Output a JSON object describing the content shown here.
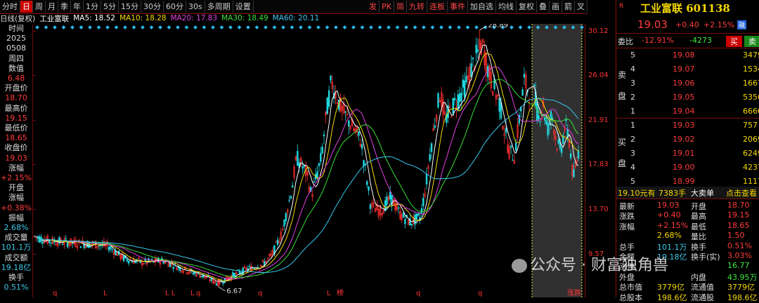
{
  "toolbar": {
    "left": [
      "分时",
      "日",
      "周",
      "月",
      "季",
      "年",
      "1分",
      "5分",
      "15分",
      "30分",
      "60分",
      "30s",
      "多周期",
      "设置"
    ],
    "active_index": 1,
    "right": [
      "发",
      "PK",
      "简",
      "九转",
      "连板",
      "事件",
      "加自选",
      "均线",
      "复权",
      "叠",
      "画",
      "箭",
      "叉"
    ]
  },
  "ma": {
    "label": "日线(复权)",
    "stock": "工业富联",
    "items": [
      {
        "text": "MA5: 18.52",
        "color": "#ffffff"
      },
      {
        "text": "MA10: 18.28",
        "color": "#f5d800"
      },
      {
        "text": "MA20: 17.83",
        "color": "#e040e0"
      },
      {
        "text": "MA30: 18.49",
        "color": "#38e038"
      },
      {
        "text": "MA60: 20.11",
        "color": "#38c8f0"
      }
    ]
  },
  "left_info": [
    {
      "t": "时间",
      "c": "lbl"
    },
    {
      "t": "2025",
      "c": "lbl"
    },
    {
      "t": "0508",
      "c": "lbl"
    },
    {
      "t": "周四",
      "c": "lbl"
    },
    {
      "t": "数值",
      "c": "lbl"
    },
    {
      "t": "6.48",
      "c": "up"
    },
    {
      "t": "开盘价",
      "c": "lbl"
    },
    {
      "t": "18.70",
      "c": "up"
    },
    {
      "t": "最高价",
      "c": "lbl"
    },
    {
      "t": "19.15",
      "c": "up"
    },
    {
      "t": "最低价",
      "c": "lbl"
    },
    {
      "t": "18.65",
      "c": "up"
    },
    {
      "t": "收盘价",
      "c": "lbl"
    },
    {
      "t": "19.03",
      "c": "up"
    },
    {
      "t": "涨幅",
      "c": "lbl"
    },
    {
      "t": "+2.15%",
      "c": "up"
    },
    {
      "t": "开盘",
      "c": "lbl"
    },
    {
      "t": "涨幅",
      "c": "lbl"
    },
    {
      "t": "+0.38%",
      "c": "up"
    },
    {
      "t": "振幅",
      "c": "lbl"
    },
    {
      "t": "2.68%",
      "c": "cy"
    },
    {
      "t": "成交量",
      "c": "lbl"
    },
    {
      "t": "101.1万",
      "c": "cy"
    },
    {
      "t": "成交额",
      "c": "lbl"
    },
    {
      "t": "19.18亿",
      "c": "cy"
    },
    {
      "t": "换手",
      "c": "lbl"
    },
    {
      "t": "0.51%",
      "c": "cy"
    }
  ],
  "axis_labels": [
    "30.12",
    "26.04",
    "21.91",
    "17.83",
    "13.70",
    "9.57"
  ],
  "chart_data": {
    "type": "candlestick",
    "y_ticks": [
      30.12,
      26.04,
      21.91,
      17.83,
      13.7,
      9.57
    ],
    "ylim": [
      5.6,
      30.8
    ],
    "annotations": [
      {
        "text": "28.89",
        "kind": "high"
      },
      {
        "text": "6.67",
        "kind": "low"
      }
    ],
    "price_path": [
      [
        0,
        11.2
      ],
      [
        0.03,
        10.8
      ],
      [
        0.08,
        10.6
      ],
      [
        0.12,
        10.5
      ],
      [
        0.15,
        10.3
      ],
      [
        0.18,
        9.2
      ],
      [
        0.22,
        8.8
      ],
      [
        0.26,
        9.0
      ],
      [
        0.3,
        8.2
      ],
      [
        0.34,
        7.6
      ],
      [
        0.37,
        6.9
      ],
      [
        0.4,
        7.6
      ],
      [
        0.43,
        8.2
      ],
      [
        0.46,
        8.6
      ],
      [
        0.48,
        9.5
      ],
      [
        0.5,
        11.5
      ],
      [
        0.52,
        15.5
      ],
      [
        0.53,
        18.5
      ],
      [
        0.55,
        17.0
      ],
      [
        0.56,
        15.0
      ],
      [
        0.58,
        18.5
      ],
      [
        0.59,
        22.5
      ],
      [
        0.6,
        25.5
      ],
      [
        0.62,
        23.0
      ],
      [
        0.64,
        21.5
      ],
      [
        0.66,
        20.0
      ],
      [
        0.67,
        17.0
      ],
      [
        0.68,
        14.0
      ],
      [
        0.7,
        13.5
      ],
      [
        0.72,
        14.8
      ],
      [
        0.74,
        13.2
      ],
      [
        0.76,
        12.5
      ],
      [
        0.78,
        13.0
      ],
      [
        0.79,
        15.5
      ],
      [
        0.8,
        19.0
      ],
      [
        0.81,
        22.0
      ],
      [
        0.82,
        24.5
      ],
      [
        0.83,
        22.0
      ],
      [
        0.85,
        23.5
      ],
      [
        0.87,
        25.0
      ],
      [
        0.89,
        27.5
      ],
      [
        0.905,
        28.89
      ],
      [
        0.92,
        26.0
      ],
      [
        0.94,
        23.5
      ],
      [
        0.95,
        21.0
      ],
      [
        0.96,
        19.0
      ],
      [
        0.97,
        18.6
      ],
      [
        0.98,
        22.0
      ],
      [
        0.99,
        25.5
      ],
      [
        1.0,
        24.5
      ]
    ],
    "price_path_tail": [
      [
        0,
        24.5
      ],
      [
        0.1,
        22.0
      ],
      [
        0.2,
        23.5
      ],
      [
        0.3,
        21.0
      ],
      [
        0.4,
        22.5
      ],
      [
        0.5,
        20.0
      ],
      [
        0.6,
        19.0
      ],
      [
        0.7,
        21.5
      ],
      [
        0.8,
        20.0
      ],
      [
        0.88,
        16.5
      ],
      [
        0.94,
        17.5
      ],
      [
        1.0,
        19.03
      ]
    ],
    "highlight_region": true,
    "bottom_markers": [
      "q",
      "L",
      "L L",
      "L",
      "q",
      "q",
      "L",
      "榜",
      "q",
      "q",
      "涨跌"
    ]
  },
  "panel": {
    "title": "工业富联 601138",
    "price": "19.03",
    "change": "+0.40",
    "pct": "+2.15%",
    "badge": "融",
    "weibi_label": "委比",
    "weibi": "-12.91%",
    "weicha": "-4273",
    "buy_btn": "买",
    "sell_btn": "卖",
    "sell_label": "卖盘",
    "buy_label": "买盘",
    "asks": [
      {
        "lvl": "5",
        "price": "19.08",
        "vol": "3479"
      },
      {
        "lvl": "4",
        "price": "19.07",
        "vol": "1534"
      },
      {
        "lvl": "3",
        "price": "19.06",
        "vol": "1667"
      },
      {
        "lvl": "2",
        "price": "19.05",
        "vol": "5356"
      },
      {
        "lvl": "1",
        "price": "19.04",
        "vol": "6660"
      }
    ],
    "bids": [
      {
        "lvl": "1",
        "price": "19.03",
        "vol": "757"
      },
      {
        "lvl": "2",
        "price": "19.02",
        "vol": "2069"
      },
      {
        "lvl": "3",
        "price": "19.01",
        "vol": "6249"
      },
      {
        "lvl": "4",
        "price": "19.00",
        "vol": "4237"
      },
      {
        "lvl": "5",
        "price": "18.99",
        "vol": "1117"
      }
    ],
    "big_order": {
      "a": "19.10元有",
      "b": "7383手",
      "c": "大卖单",
      "d": "点击查看"
    },
    "stats": [
      {
        "l1": "最新",
        "v1": "19.03",
        "c1": "up",
        "l2": "开盘",
        "v2": "18.70",
        "c2": "up"
      },
      {
        "l1": "涨跌",
        "v1": "+0.40",
        "c1": "up",
        "l2": "最高",
        "v2": "19.15",
        "c2": "up"
      },
      {
        "l1": "涨幅",
        "v1": "+2.15%",
        "c1": "up",
        "l2": "最低",
        "v2": "18.65",
        "c2": "up"
      },
      {
        "l1": "",
        "v1": "2.68%",
        "c1": "yl",
        "l2": "量比",
        "v2": "1.50",
        "c2": "up"
      },
      {
        "l1": "总手",
        "v1": "101.1万",
        "c1": "cy",
        "l2": "换手",
        "v2": "0.51%",
        "c2": "up"
      },
      {
        "l1": "金额",
        "v1": "19.18亿",
        "c1": "cy",
        "l2": "换手(实)",
        "v2": "3.03%",
        "c2": "up"
      },
      {
        "l1": "涨停",
        "v1": "",
        "c1": "up",
        "l2": "",
        "v2": "16.77",
        "c2": "gr"
      },
      {
        "l1": "外盘",
        "v1": "",
        "c1": "up",
        "l2": "内盘",
        "v2": "43.95万",
        "c2": "gr"
      },
      {
        "l1": "总市值",
        "v1": "3779亿",
        "c1": "yl",
        "l2": "流通值",
        "v2": "3779亿",
        "c2": "yl"
      },
      {
        "l1": "总股本",
        "v1": "198.6亿",
        "c1": "yl",
        "l2": "流通股",
        "v2": "198.6亿",
        "c2": "yl"
      }
    ]
  },
  "watermark": "公众号 · 财富独角兽"
}
